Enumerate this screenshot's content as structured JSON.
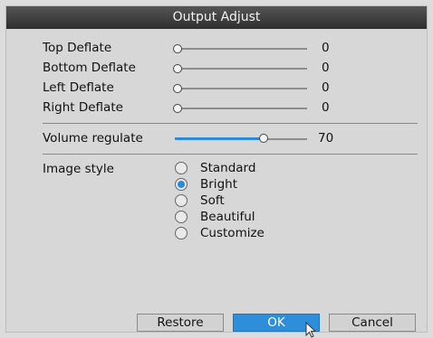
{
  "title": "Output Adjust",
  "deflate_rows": [
    {
      "label": "Top Deflate",
      "value": "0",
      "level": 0
    },
    {
      "label": "Bottom Deflate",
      "value": "0",
      "level": 0
    },
    {
      "label": "Left Deflate",
      "value": "0",
      "level": 0
    },
    {
      "label": "Right Deflate",
      "value": "0",
      "level": 0
    }
  ],
  "volume": {
    "label": "Volume regulate",
    "value": "70",
    "level": 0.7
  },
  "image_style": {
    "label": "Image style",
    "options": [
      "Standard",
      "Bright",
      "Soft",
      "Beautiful",
      "Customize"
    ],
    "selected": "Bright"
  },
  "buttons": {
    "restore": "Restore",
    "ok": "OK",
    "cancel": "Cancel"
  },
  "colors": {
    "accent": "#2a8bd8",
    "title_bar": "#3a3a3a",
    "background": "#d7d7d7"
  }
}
